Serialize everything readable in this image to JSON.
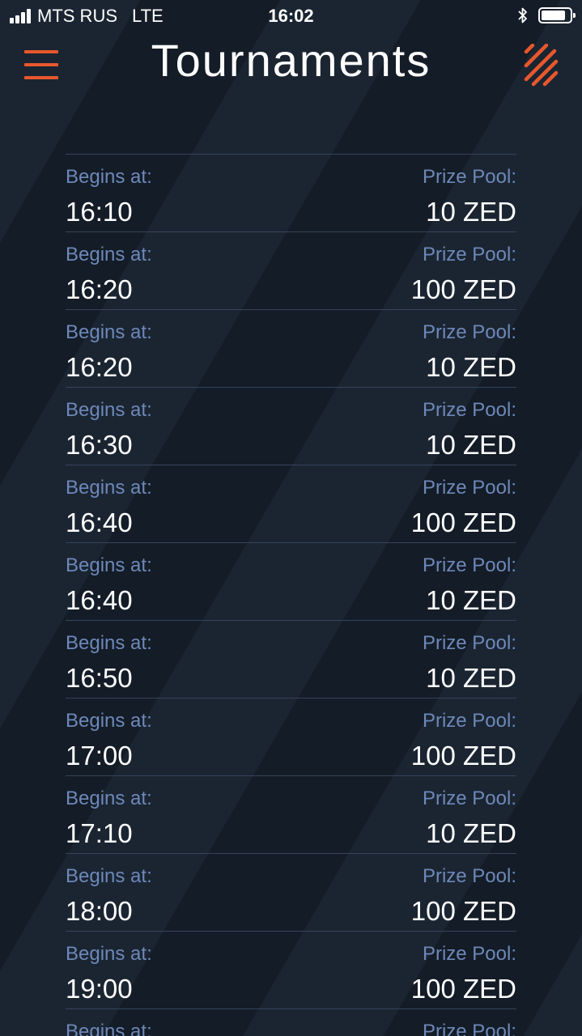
{
  "status_bar": {
    "carrier": "MTS RUS",
    "network": "LTE",
    "time": "16:02",
    "battery_level": 0.85
  },
  "header": {
    "title": "Tournaments",
    "menu_icon": "hamburger-menu-icon",
    "logo_icon": "brand-slash-logo"
  },
  "colors": {
    "accent": "#e8572c",
    "label": "#6d88b8",
    "value": "#ffffff",
    "background": "#17202c",
    "divider": "#34445a"
  },
  "tournaments": [
    {
      "begins_label": "Begins at:",
      "time": "16:10",
      "prize_label": "Prize Pool:",
      "prize": "10 ZED"
    },
    {
      "begins_label": "Begins at:",
      "time": "16:20",
      "prize_label": "Prize Pool:",
      "prize": "100 ZED"
    },
    {
      "begins_label": "Begins at:",
      "time": "16:20",
      "prize_label": "Prize Pool:",
      "prize": "10 ZED"
    },
    {
      "begins_label": "Begins at:",
      "time": "16:30",
      "prize_label": "Prize Pool:",
      "prize": "10 ZED"
    },
    {
      "begins_label": "Begins at:",
      "time": "16:40",
      "prize_label": "Prize Pool:",
      "prize": "100 ZED"
    },
    {
      "begins_label": "Begins at:",
      "time": "16:40",
      "prize_label": "Prize Pool:",
      "prize": "10 ZED"
    },
    {
      "begins_label": "Begins at:",
      "time": "16:50",
      "prize_label": "Prize Pool:",
      "prize": "10 ZED"
    },
    {
      "begins_label": "Begins at:",
      "time": "17:00",
      "prize_label": "Prize Pool:",
      "prize": "100 ZED"
    },
    {
      "begins_label": "Begins at:",
      "time": "17:10",
      "prize_label": "Prize Pool:",
      "prize": "10 ZED"
    },
    {
      "begins_label": "Begins at:",
      "time": "18:00",
      "prize_label": "Prize Pool:",
      "prize": "100 ZED"
    },
    {
      "begins_label": "Begins at:",
      "time": "19:00",
      "prize_label": "Prize Pool:",
      "prize": "100 ZED"
    },
    {
      "begins_label": "Begins at:",
      "time": "",
      "prize_label": "Prize Pool:",
      "prize": ""
    }
  ]
}
